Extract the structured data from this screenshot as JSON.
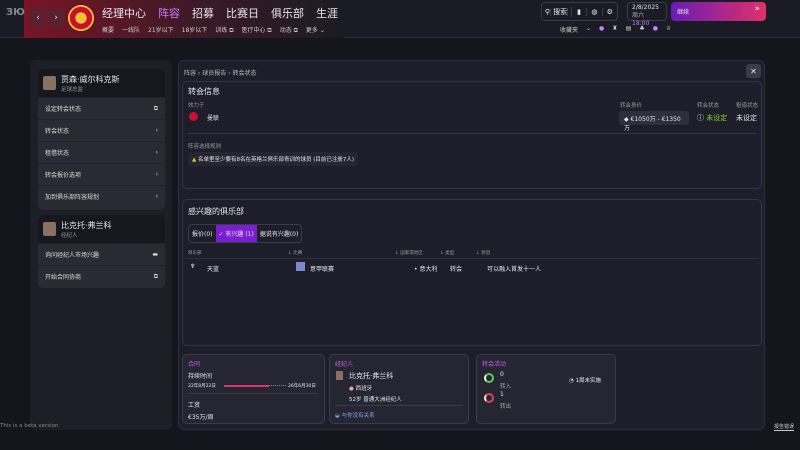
{
  "header": {
    "logo": "ЗЮ",
    "nav": [
      "经理中心",
      "阵容",
      "招募",
      "比赛日",
      "俱乐部",
      "生涯"
    ],
    "subnav": [
      "概要",
      "一线队",
      "21岁以下",
      "18岁以下",
      "训练 ⧉",
      "医疗中心 ⧉",
      "动态 ⧉",
      "更多 ⌄"
    ],
    "search": "搜索",
    "date": "2/8/2025",
    "weekday": "周六",
    "time": "18:00",
    "continue": "继续",
    "favorites": "收藏夹"
  },
  "left": {
    "player_name": "贾森·威尔科克斯",
    "player_role": "足球总监",
    "items": [
      "设定转会状态",
      "转会状态",
      "租借状态",
      "转会报价选项",
      "加到俱乐部阵容规划"
    ],
    "agent_name": "比克托·弗兰科",
    "agent_role": "经纪人",
    "agent_items": [
      "询问经纪人市场兴趣",
      "开始合同协商"
    ]
  },
  "breadcrumb": [
    "阵容",
    "球员报告",
    "转会状态"
  ],
  "transfer": {
    "title": "转会信息",
    "plays_for_label": "效力于",
    "club": "曼联",
    "value_label": "转会身价",
    "value": "€1050万 - €1350万",
    "status_label": "转会状态",
    "status": "未设定",
    "loan_label": "租借状态",
    "loan": "未设定",
    "rules_label": "阵容选择规则",
    "rule": "名单里至少要有8名在英格兰俱乐部青训的球员 (目前已注册7人)"
  },
  "interest": {
    "title": "感兴趣的俱乐部",
    "tabs": [
      "报价(0)",
      "✓ 有兴趣 (1)",
      "据说有兴趣(0)"
    ],
    "cols": [
      "俱乐部",
      "比赛",
      "国家或地区",
      "类型",
      "原因"
    ],
    "rows": [
      {
        "club": "天蓝",
        "league": "意甲联赛",
        "country": "意大利",
        "type": "转会",
        "reason": "可以融入首发十一人"
      }
    ]
  },
  "contract": {
    "title": "合同",
    "duration_label": "持续时间",
    "start": "22年8月22日",
    "end": "26年6月30日",
    "progress": 0.72,
    "wage_label": "工资",
    "wage": "€35万/周"
  },
  "agent": {
    "title": "经纪人",
    "name": "比克托·弗兰科",
    "nation": "西班牙",
    "desc": "52岁 普通大洲经纪人",
    "relation": "与你没有关系"
  },
  "activity": {
    "title": "转会活动",
    "in_count": "0",
    "in_label": "转入",
    "out_count": "1",
    "out_label": "转出",
    "note": "1周未实施"
  },
  "footer": {
    "beta": "This is a beta version",
    "report": "报告错误"
  }
}
